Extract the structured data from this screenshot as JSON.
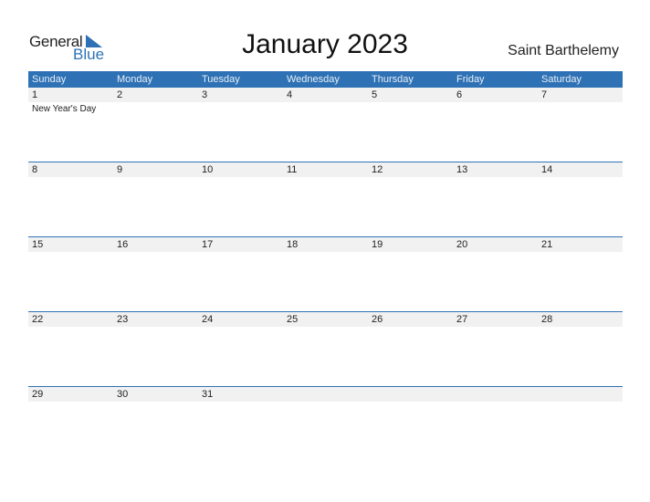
{
  "logo": {
    "line1": "General",
    "line2": "Blue"
  },
  "title": "January 2023",
  "country": "Saint Barthelemy",
  "weekdays": [
    "Sunday",
    "Monday",
    "Tuesday",
    "Wednesday",
    "Thursday",
    "Friday",
    "Saturday"
  ],
  "weeks": [
    {
      "days": [
        "1",
        "2",
        "3",
        "4",
        "5",
        "6",
        "7"
      ],
      "events": [
        "New Year's Day",
        "",
        "",
        "",
        "",
        "",
        ""
      ]
    },
    {
      "days": [
        "8",
        "9",
        "10",
        "11",
        "12",
        "13",
        "14"
      ],
      "events": [
        "",
        "",
        "",
        "",
        "",
        "",
        ""
      ]
    },
    {
      "days": [
        "15",
        "16",
        "17",
        "18",
        "19",
        "20",
        "21"
      ],
      "events": [
        "",
        "",
        "",
        "",
        "",
        "",
        ""
      ]
    },
    {
      "days": [
        "22",
        "23",
        "24",
        "25",
        "26",
        "27",
        "28"
      ],
      "events": [
        "",
        "",
        "",
        "",
        "",
        "",
        ""
      ]
    },
    {
      "days": [
        "29",
        "30",
        "31",
        "",
        "",
        "",
        ""
      ],
      "events": [
        "",
        "",
        "",
        "",
        "",
        "",
        ""
      ]
    }
  ],
  "colors": {
    "accent": "#2e72b5",
    "day_row_bg": "#f1f1f1"
  }
}
